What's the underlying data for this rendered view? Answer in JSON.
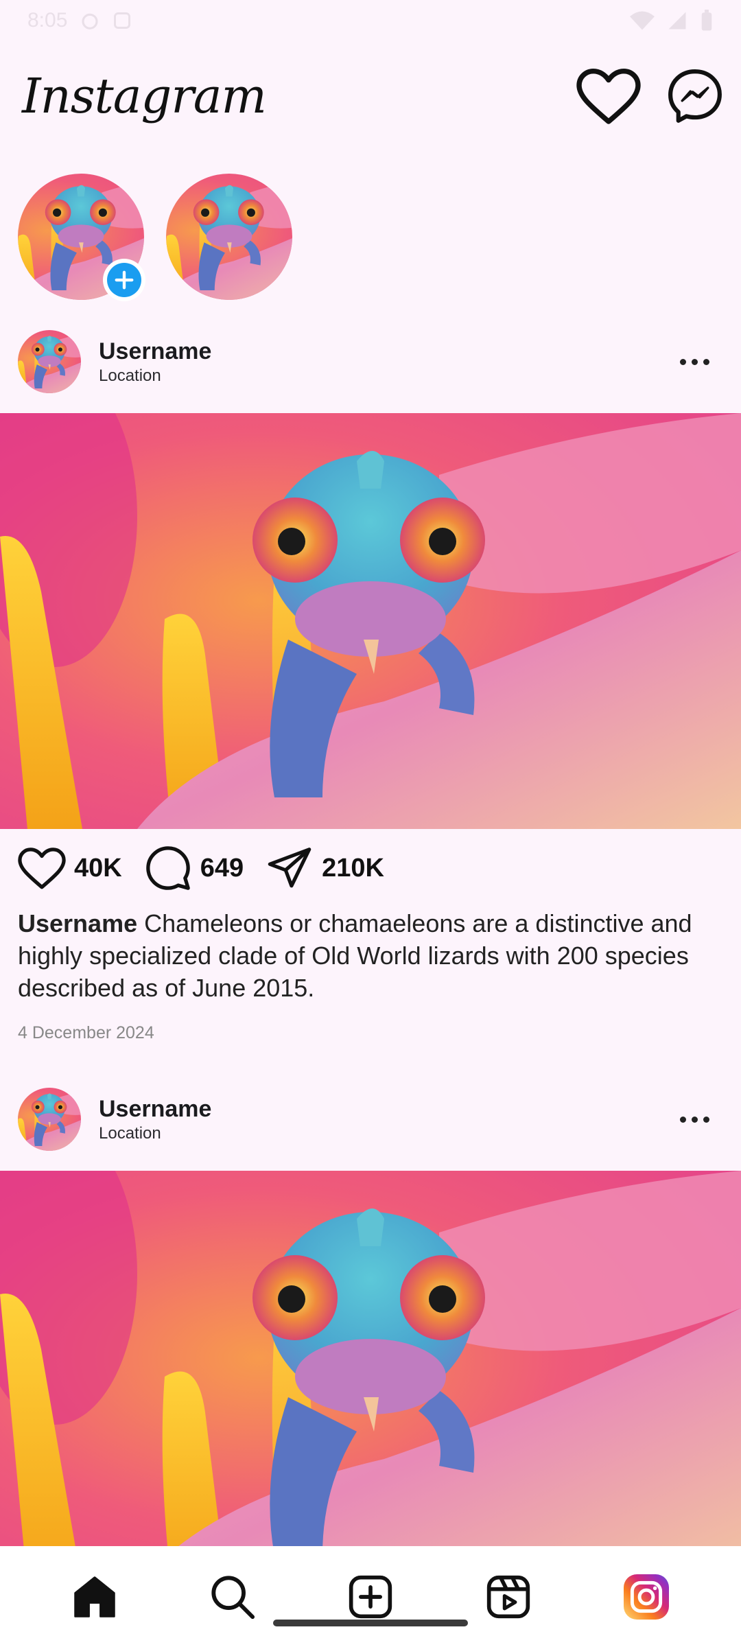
{
  "status_bar": {
    "time": "8:05"
  },
  "header": {
    "logo_text": "Instagram"
  },
  "icons": {
    "notifications": "heart-icon",
    "messages": "messenger-icon",
    "add_story": "plus-icon",
    "more": "more-horizontal-icon",
    "like": "heart-icon",
    "comment": "comment-icon",
    "share": "send-icon",
    "nav": [
      "home-icon",
      "search-icon",
      "add-post-icon",
      "reels-icon",
      "instagram-profile-icon"
    ]
  },
  "colors": {
    "background": "#fdf4fc",
    "add_badge": "#1a9df0",
    "nav_background": "#ffffff"
  },
  "posts": [
    {
      "username": "Username",
      "location": "Location",
      "likes": "40K",
      "comments": "649",
      "shares": "210K",
      "caption_user": "Username",
      "caption_text": "Chameleons or chamaeleons are a distinctive and highly specialized clade of Old World lizards with 200 species described as of June 2015.",
      "date": "4 December 2024"
    },
    {
      "username": "Username",
      "location": "Location"
    }
  ]
}
